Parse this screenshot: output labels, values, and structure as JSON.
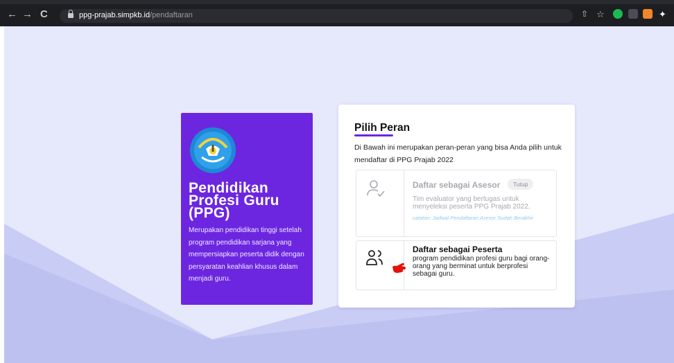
{
  "browser": {
    "url_host": "ppg-prajab.simpkb.id",
    "url_path": "/pendaftaran",
    "nav_back": "←",
    "nav_forward": "→",
    "nav_reload": "C",
    "ext_share": "⇧",
    "ext_star": "☆",
    "ext_puzzle": "✦"
  },
  "brand_card": {
    "title_line1": "Pendidikan",
    "title_line2": "Profesi Guru",
    "title_line3": "(PPG)",
    "description": "Merupakan pendidikan tinggi setelah program pendidikan sarjana yang mempersiapkan peserta didik dengan persyaratan keahlian khusus dalam menjadi guru."
  },
  "role_card": {
    "title": "Pilih Peran",
    "description": "Di Bawah ini merupakan peran-peran yang bisa Anda pilih untuk mendaftar di PPG Prajab 2022",
    "options": [
      {
        "title": "Daftar sebagai Asesor",
        "badge": "Tutup",
        "description": "Tim evaluator yang bertugas untuk menyeleksi peserta PPG Prajab 2022.",
        "note": "catatan: Jadwal Pendaftaran Asesor Sudah Berakhir",
        "icon": "user-check-icon"
      },
      {
        "title": "Daftar sebagai Peserta",
        "description": "program pendidikan profesi guru bagi orang-orang yang berminat untuk berprofesi sebagai guru.",
        "icon": "users-icon"
      }
    ]
  },
  "colors": {
    "brand_purple": "#6c26e0",
    "page_bg": "#e6e8fb",
    "note_blue": "#98c7ee"
  }
}
